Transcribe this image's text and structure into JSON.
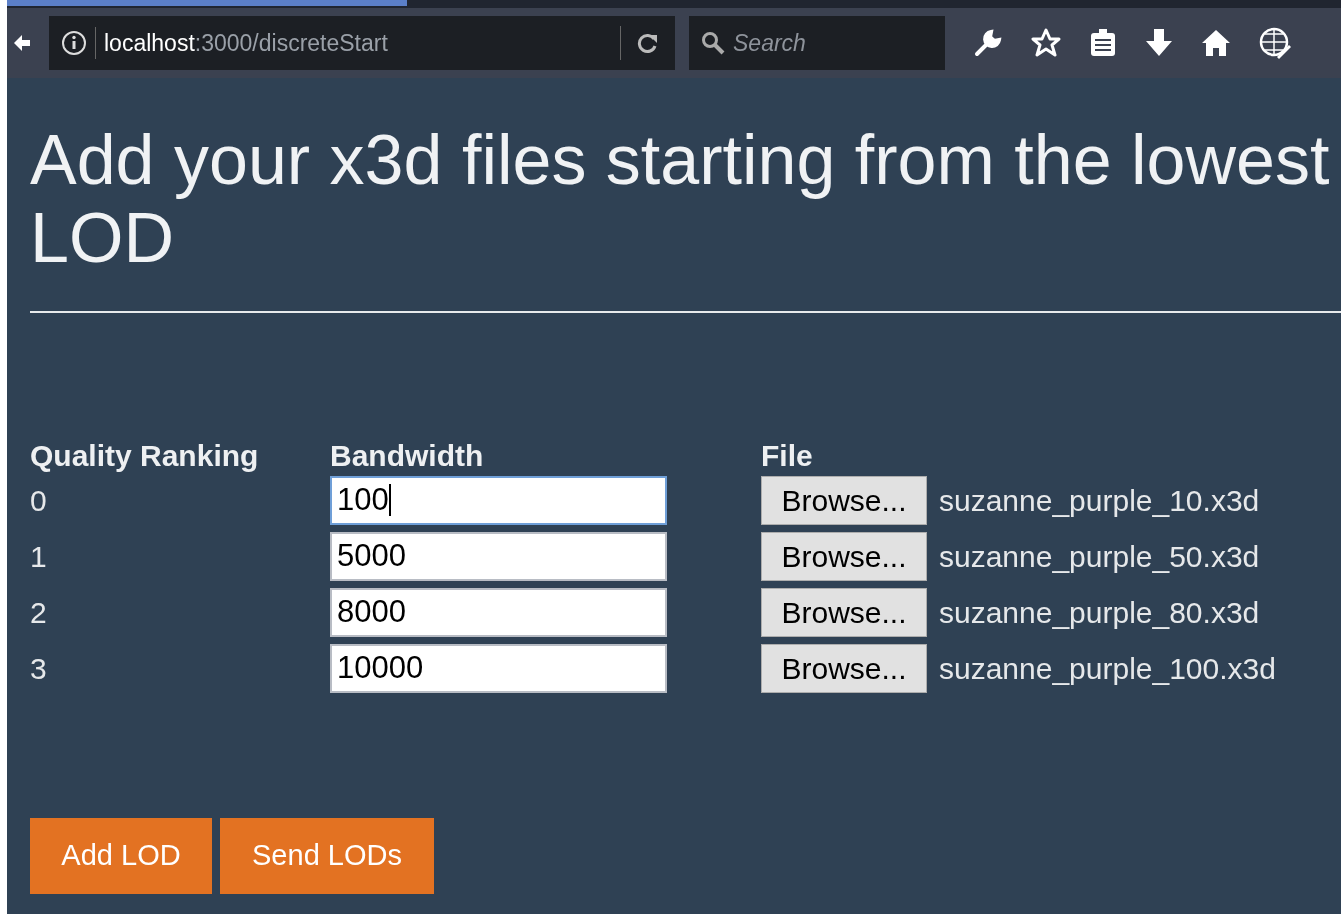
{
  "browser": {
    "loading": {
      "level": 0.3
    },
    "url": {
      "host": "localhost",
      "path": ":3000/discreteStart"
    },
    "search": {
      "placeholder": "Search"
    }
  },
  "heading": "Add your x3d files starting from the lowest LOD",
  "table": {
    "columns": [
      "Quality Ranking",
      "Bandwidth",
      "File"
    ],
    "rows": [
      {
        "rank": "0",
        "bandwidth": "100",
        "focused": true,
        "browse": "Browse...",
        "file": "suzanne_purple_10.x3d"
      },
      {
        "rank": "1",
        "bandwidth": "5000",
        "focused": false,
        "browse": "Browse...",
        "file": "suzanne_purple_50.x3d"
      },
      {
        "rank": "2",
        "bandwidth": "8000",
        "focused": false,
        "browse": "Browse...",
        "file": "suzanne_purple_80.x3d"
      },
      {
        "rank": "3",
        "bandwidth": "10000",
        "focused": false,
        "browse": "Browse...",
        "file": "suzanne_purple_100.x3d"
      }
    ]
  },
  "buttons": [
    "Add LOD",
    "Send LODs"
  ]
}
